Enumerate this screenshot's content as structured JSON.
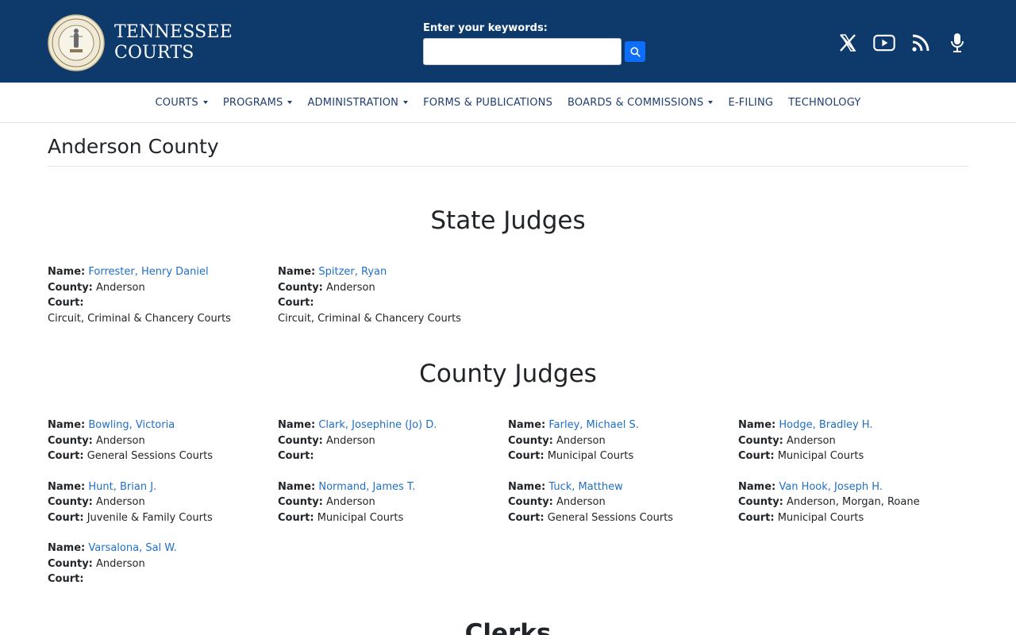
{
  "header": {
    "logo_line1": "TENNESSEE",
    "logo_line2": "COURTS",
    "search_label": "Enter your keywords:",
    "search_value": "",
    "social_icons": [
      "x-icon",
      "youtube-icon",
      "rss-icon",
      "podcast-microphone-icon"
    ]
  },
  "nav": {
    "items": [
      {
        "label": "COURTS",
        "dropdown": true
      },
      {
        "label": "PROGRAMS",
        "dropdown": true
      },
      {
        "label": "ADMINISTRATION",
        "dropdown": true
      },
      {
        "label": "FORMS & PUBLICATIONS",
        "dropdown": false
      },
      {
        "label": "BOARDS & COMMISSIONS",
        "dropdown": true
      },
      {
        "label": "E-FILING",
        "dropdown": false
      },
      {
        "label": "TECHNOLOGY",
        "dropdown": false
      }
    ]
  },
  "labels": {
    "name": "Name:",
    "county": "County:",
    "court": "Court:"
  },
  "page_title": "Anderson County",
  "state_judges": {
    "title": "State Judges",
    "judges": [
      {
        "name": "Forrester, Henry Daniel",
        "county": "Anderson",
        "court": "Circuit, Criminal & Chancery Courts"
      },
      {
        "name": "Spitzer, Ryan",
        "county": "Anderson",
        "court": "Circuit, Criminal & Chancery Courts"
      }
    ]
  },
  "county_judges": {
    "title": "County Judges",
    "judges": [
      {
        "name": "Bowling, Victoria",
        "county": "Anderson",
        "court": "General Sessions Courts"
      },
      {
        "name": "Clark, Josephine (Jo) D.",
        "county": "Anderson",
        "court": ""
      },
      {
        "name": "Farley, Michael S.",
        "county": "Anderson",
        "court": "Municipal Courts"
      },
      {
        "name": "Hodge, Bradley H.",
        "county": "Anderson",
        "court": "Municipal Courts"
      },
      {
        "name": "Hunt, Brian J.",
        "county": "Anderson",
        "court": "Juvenile & Family Courts"
      },
      {
        "name": "Normand, James T.",
        "county": "Anderson",
        "court": "Municipal Courts"
      },
      {
        "name": "Tuck, Matthew",
        "county": "Anderson",
        "court": "General Sessions Courts"
      },
      {
        "name": "Van Hook, Joseph H.",
        "county": "Anderson, Morgan, Roane",
        "court": "Municipal Courts"
      },
      {
        "name": "Varsalona, Sal W.",
        "county": "Anderson",
        "court": ""
      }
    ]
  },
  "next_section_title": "Clerks"
}
